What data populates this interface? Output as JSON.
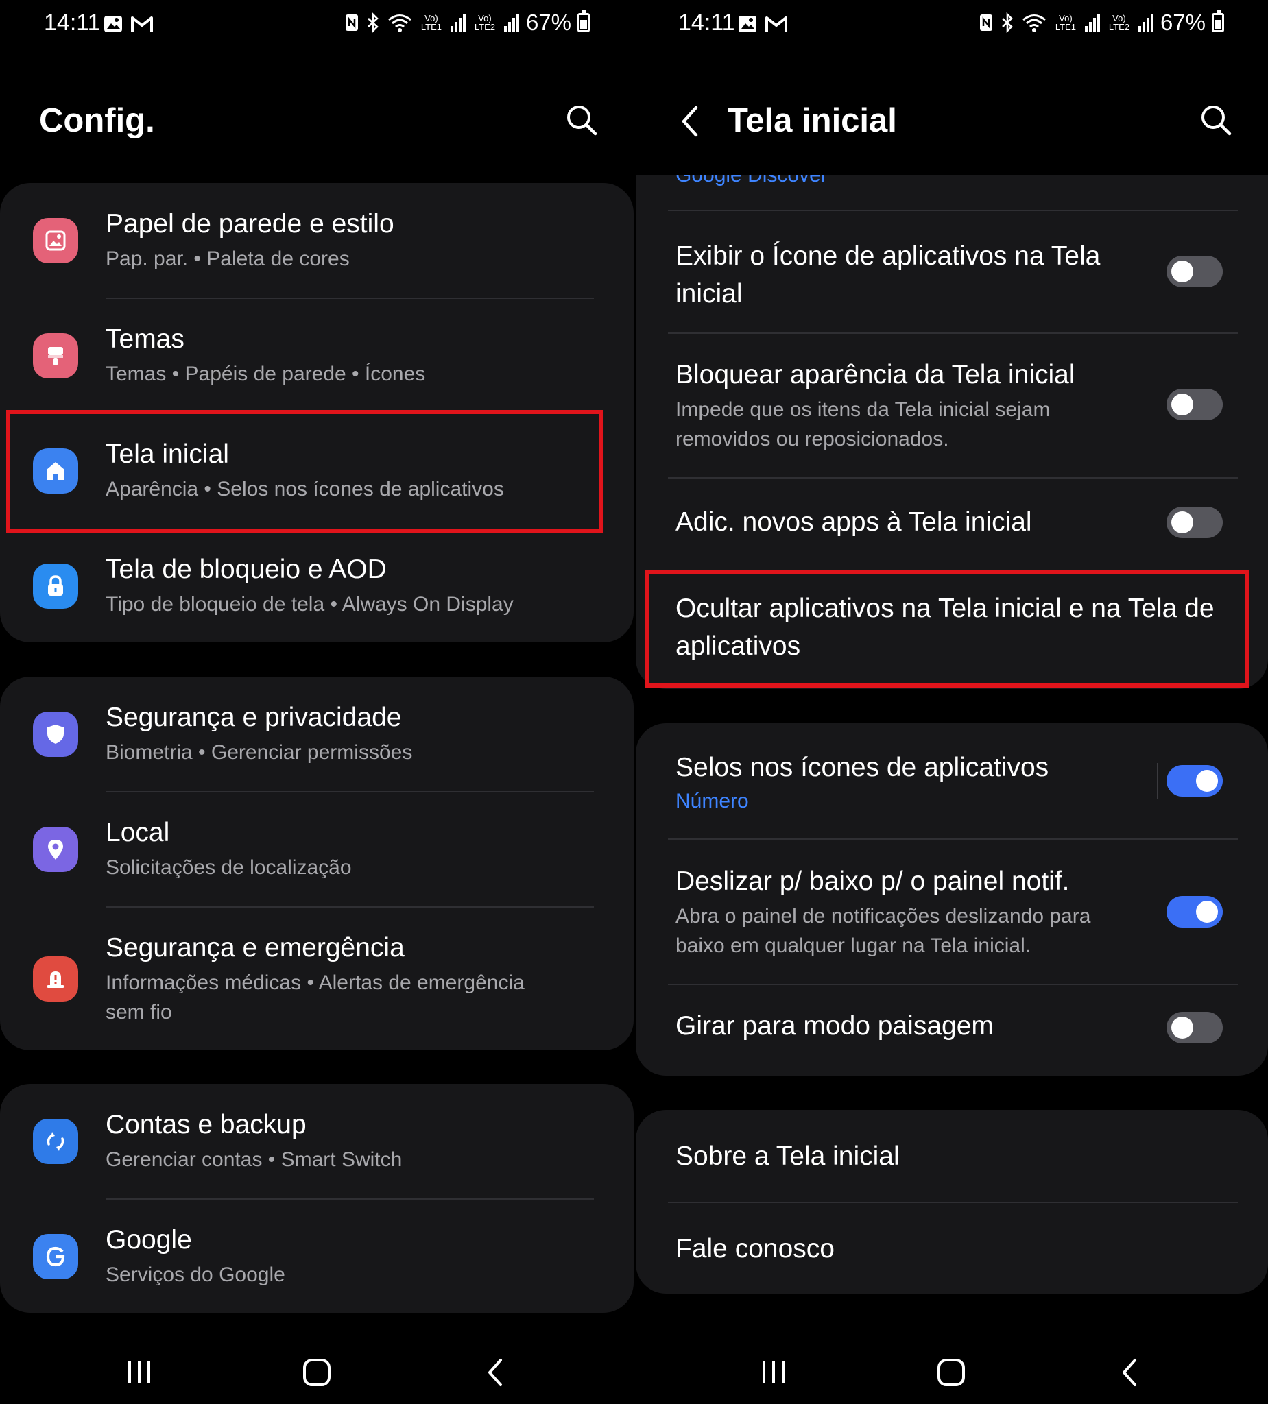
{
  "status_bar": {
    "time": "14:11",
    "battery": "67%",
    "lte1": "Vo)\nLTE1",
    "lte2": "Vo)\nLTE2",
    "icons": [
      "gallery-icon",
      "gmail-icon",
      "nfc-icon",
      "bluetooth-icon",
      "wifi-icon",
      "signal-icon",
      "battery-icon"
    ]
  },
  "left": {
    "title": "Config.",
    "groups": [
      {
        "items": [
          {
            "title": "Papel de parede e estilo",
            "subtitle": "Pap. par.  •  Paleta de cores",
            "icon": "wallpaper-icon",
            "color": "#e46278"
          },
          {
            "title": "Temas",
            "subtitle": "Temas  •  Papéis de parede  •  Ícones",
            "icon": "themes-brush-icon",
            "color": "#e46278"
          },
          {
            "title": "Tela inicial",
            "subtitle": "Aparência  •  Selos nos ícones de aplicativos",
            "icon": "home-icon",
            "color": "#3b82f0"
          },
          {
            "title": "Tela de bloqueio e AOD",
            "subtitle": "Tipo de bloqueio de tela  •  Always On Display",
            "icon": "lock-icon",
            "color": "#2a8cf0"
          }
        ]
      },
      {
        "items": [
          {
            "title": "Segurança e privacidade",
            "subtitle": "Biometria  •  Gerenciar permissões",
            "icon": "shield-icon",
            "color": "#6568e6"
          },
          {
            "title": "Local",
            "subtitle": "Solicitações de localização",
            "icon": "location-pin-icon",
            "color": "#7b66e3"
          },
          {
            "title": "Segurança e emergência",
            "subtitle": "Informações médicas  •  Alertas de emergência",
            "subtitle2": "sem fio",
            "icon": "emergency-icon",
            "color": "#e04b40"
          }
        ]
      },
      {
        "items": [
          {
            "title": "Contas e backup",
            "subtitle": "Gerenciar contas  •  Smart Switch",
            "icon": "sync-icon",
            "color": "#2f7be8"
          },
          {
            "title": "Google",
            "subtitle": "Serviços do Google",
            "icon": "google-icon",
            "color": "#3b82f0"
          }
        ]
      }
    ]
  },
  "right": {
    "title": "Tela inicial",
    "cut_off_item": "Google Discover",
    "items": [
      {
        "title": "Exibir o Ícone de aplicativos na Tela inicial",
        "toggle": false
      },
      {
        "title": "Bloquear aparência da Tela inicial",
        "subtitle": "Impede que os itens da Tela inicial sejam removidos ou reposicionados.",
        "toggle": false
      },
      {
        "title": "Adic. novos apps à Tela inicial",
        "toggle": false
      },
      {
        "title": "Ocultar aplicativos na Tela inicial e na Tela de aplicativos"
      }
    ],
    "items2": [
      {
        "title": "Selos nos ícones de aplicativos",
        "link": "Número",
        "toggle": true
      },
      {
        "title": "Deslizar p/ baixo p/ o painel notif.",
        "subtitle": "Abra o painel de notificações deslizando para baixo em qualquer lugar na Tela inicial.",
        "toggle": true
      },
      {
        "title": "Girar para modo paisagem",
        "toggle": false
      }
    ],
    "items3": [
      {
        "title": "Sobre a Tela inicial"
      },
      {
        "title": "Fale conosco"
      }
    ]
  },
  "colors": {
    "card": "#171719",
    "accent": "#3b6ff5",
    "link": "#3e84ff",
    "highlight": "#e0141b"
  }
}
